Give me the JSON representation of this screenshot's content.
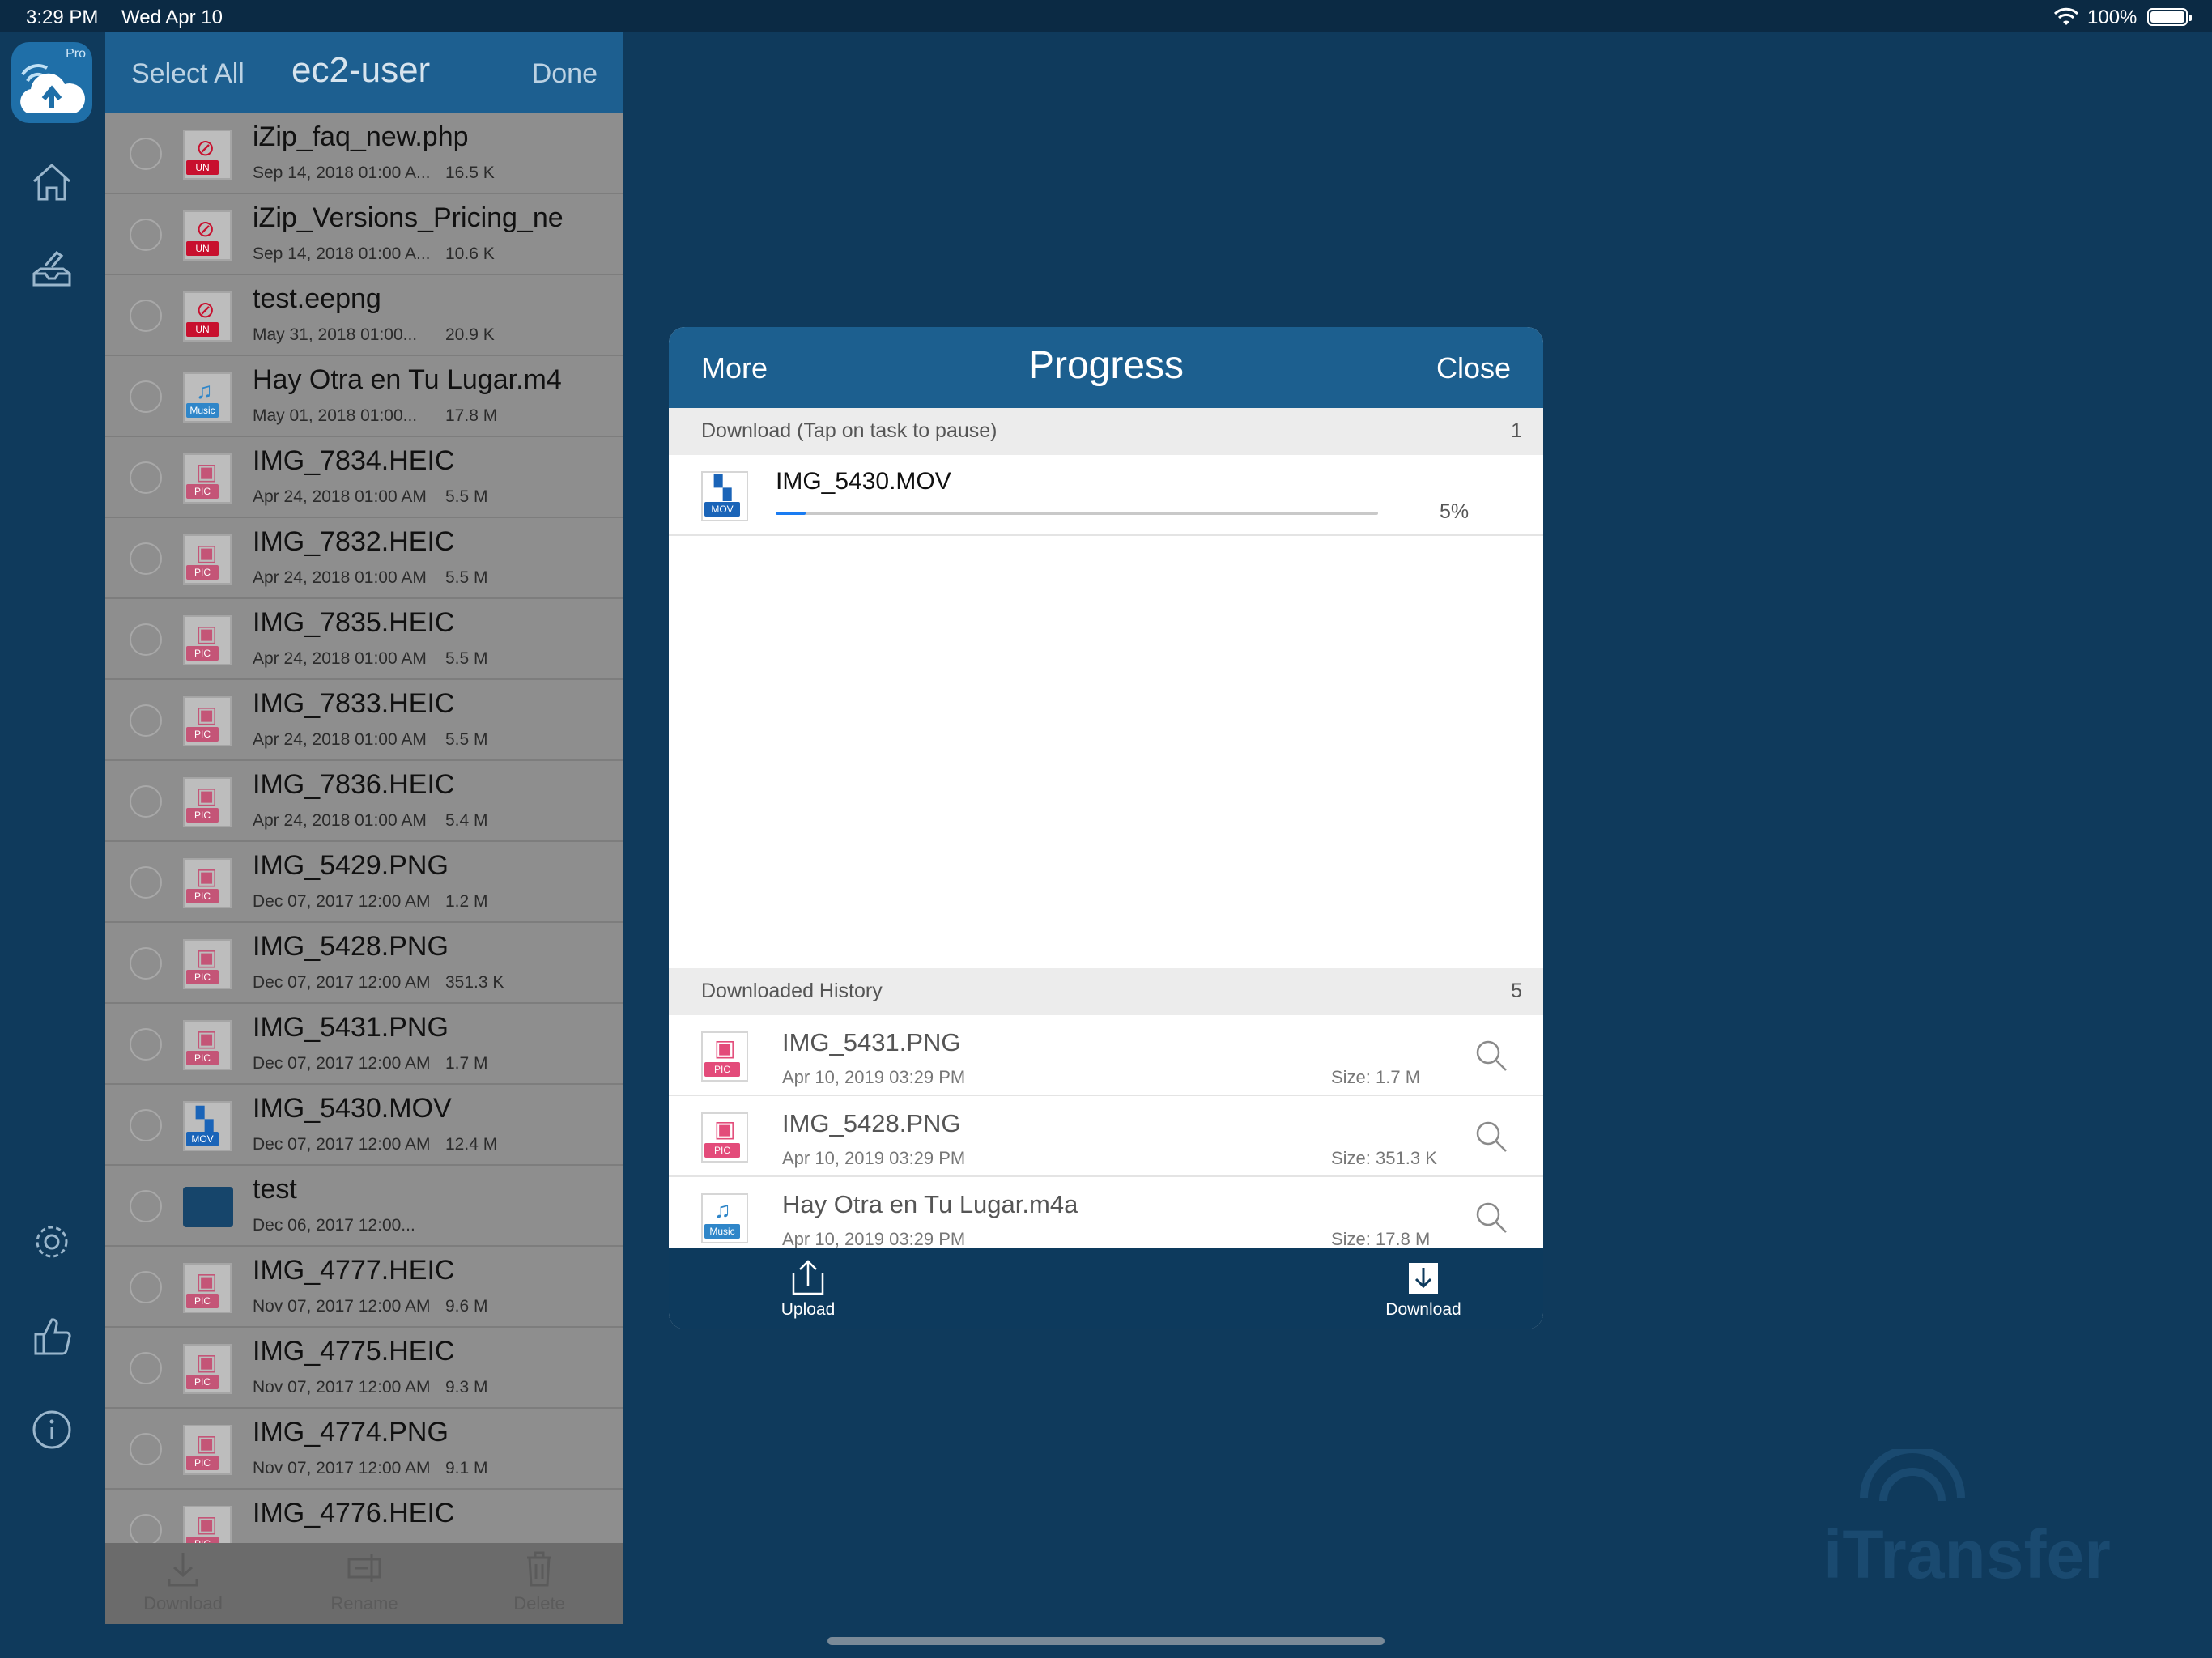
{
  "status_bar": {
    "time": "3:29 PM",
    "date": "Wed Apr 10",
    "battery": "100%"
  },
  "app": {
    "badge": "Pro"
  },
  "file_panel": {
    "select_all": "Select All",
    "title": "ec2-user",
    "done": "Done",
    "files": [
      {
        "name": "iZip_faq_new.php",
        "date": "Sep 14, 2018 01:00 A...",
        "size": "16.5 K",
        "type": "UN",
        "tag_color": "#c8102e",
        "glyph": "⊘"
      },
      {
        "name": "iZip_Versions_Pricing_ne",
        "date": "Sep 14, 2018 01:00 A...",
        "size": "10.6 K",
        "type": "UN",
        "tag_color": "#c8102e",
        "glyph": "⊘"
      },
      {
        "name": "test.eepng",
        "date": "May 31, 2018 01:00...",
        "size": "20.9 K",
        "type": "UN",
        "tag_color": "#c8102e",
        "glyph": "⊘"
      },
      {
        "name": "Hay Otra en Tu Lugar.m4",
        "date": "May 01, 2018 01:00...",
        "size": "17.8 M",
        "type": "Music",
        "tag_color": "#2f86c9",
        "glyph": "♫"
      },
      {
        "name": "IMG_7834.HEIC",
        "date": "Apr 24, 2018 01:00 AM",
        "size": "5.5 M",
        "type": "PIC",
        "tag_color": "#c45577",
        "glyph": "▣"
      },
      {
        "name": "IMG_7832.HEIC",
        "date": "Apr 24, 2018 01:00 AM",
        "size": "5.5 M",
        "type": "PIC",
        "tag_color": "#c45577",
        "glyph": "▣"
      },
      {
        "name": "IMG_7835.HEIC",
        "date": "Apr 24, 2018 01:00 AM",
        "size": "5.5 M",
        "type": "PIC",
        "tag_color": "#c45577",
        "glyph": "▣"
      },
      {
        "name": "IMG_7833.HEIC",
        "date": "Apr 24, 2018 01:00 AM",
        "size": "5.5 M",
        "type": "PIC",
        "tag_color": "#c45577",
        "glyph": "▣"
      },
      {
        "name": "IMG_7836.HEIC",
        "date": "Apr 24, 2018 01:00 AM",
        "size": "5.4 M",
        "type": "PIC",
        "tag_color": "#c45577",
        "glyph": "▣"
      },
      {
        "name": "IMG_5429.PNG",
        "date": "Dec 07, 2017 12:00 AM",
        "size": "1.2 M",
        "type": "PIC",
        "tag_color": "#c45577",
        "glyph": "▣"
      },
      {
        "name": "IMG_5428.PNG",
        "date": "Dec 07, 2017 12:00 AM",
        "size": "351.3 K",
        "type": "PIC",
        "tag_color": "#c45577",
        "glyph": "▣"
      },
      {
        "name": "IMG_5431.PNG",
        "date": "Dec 07, 2017 12:00 AM",
        "size": "1.7 M",
        "type": "PIC",
        "tag_color": "#c45577",
        "glyph": "▣"
      },
      {
        "name": "IMG_5430.MOV",
        "date": "Dec 07, 2017 12:00 AM",
        "size": "12.4 M",
        "type": "MOV",
        "tag_color": "#1a64b8",
        "glyph": "▚"
      },
      {
        "name": "test",
        "date": "Dec 06, 2017 12:00...",
        "size": "",
        "type": "folder",
        "tag_color": "#16456b",
        "glyph": ""
      },
      {
        "name": "IMG_4777.HEIC",
        "date": "Nov 07, 2017 12:00 AM",
        "size": "9.6 M",
        "type": "PIC",
        "tag_color": "#c45577",
        "glyph": "▣"
      },
      {
        "name": "IMG_4775.HEIC",
        "date": "Nov 07, 2017 12:00 AM",
        "size": "9.3 M",
        "type": "PIC",
        "tag_color": "#c45577",
        "glyph": "▣"
      },
      {
        "name": "IMG_4774.PNG",
        "date": "Nov 07, 2017 12:00 AM",
        "size": "9.1 M",
        "type": "PIC",
        "tag_color": "#c45577",
        "glyph": "▣"
      },
      {
        "name": "IMG_4776.HEIC",
        "date": "",
        "size": "",
        "type": "PIC",
        "tag_color": "#c45577",
        "glyph": "▣"
      }
    ],
    "toolbar": {
      "download": "Download",
      "rename": "Rename",
      "delete": "Delete"
    }
  },
  "progress_modal": {
    "more": "More",
    "title": "Progress",
    "close": "Close",
    "download_section": {
      "label": "Download (Tap on task to pause)",
      "count": "1"
    },
    "task": {
      "name": "IMG_5430.MOV",
      "type": "MOV",
      "progress_percent": 5,
      "percent_label": "5%"
    },
    "history_section": {
      "label": "Downloaded History",
      "count": "5"
    },
    "history": [
      {
        "name": "IMG_5431.PNG",
        "date": "Apr 10, 2019 03:29 PM",
        "size": "Size: 1.7 M",
        "type": "PIC",
        "tag_color": "#e34b7a",
        "glyph": "▣"
      },
      {
        "name": "IMG_5428.PNG",
        "date": "Apr 10, 2019 03:29 PM",
        "size": "Size: 351.3 K",
        "type": "PIC",
        "tag_color": "#e34b7a",
        "glyph": "▣"
      },
      {
        "name": "Hay Otra en Tu Lugar.m4a",
        "date": "Apr 10, 2019 03:29 PM",
        "size": "Size: 17.8 M",
        "type": "Music",
        "tag_color": "#2f86c9",
        "glyph": "♫"
      }
    ],
    "footer": {
      "upload": "Upload",
      "download": "Download"
    }
  },
  "watermark": {
    "text": "iTransfer"
  },
  "colors": {
    "background": "#0f3a5c",
    "header_blue": "#1c5f8f",
    "progress_blue": "#1a7cf2"
  }
}
